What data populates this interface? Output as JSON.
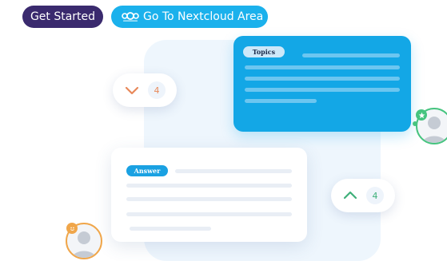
{
  "header": {
    "get_started_label": "Get Started",
    "nextcloud_label": "Go To Nextcloud Area"
  },
  "topics_card": {
    "tag_label": "Topics"
  },
  "answer_card": {
    "tag_label": "Answer"
  },
  "votes": {
    "down_count": "4",
    "up_count": "4"
  },
  "colors": {
    "primary_dark": "#3a2a6e",
    "brand_blue": "#1bb1ec",
    "card_blue": "#13a7e6",
    "downvote": "#e8895a",
    "upvote": "#3fb07a",
    "avatar_green": "#46c47f",
    "avatar_orange": "#f0a64a"
  },
  "icons": {
    "nextcloud": "nextcloud-logo-icon",
    "down": "chevron-down-icon",
    "up": "chevron-up-icon",
    "avatar": "user-avatar-icon",
    "star_badge": "star-badge-icon",
    "smile_badge": "smile-badge-icon"
  }
}
